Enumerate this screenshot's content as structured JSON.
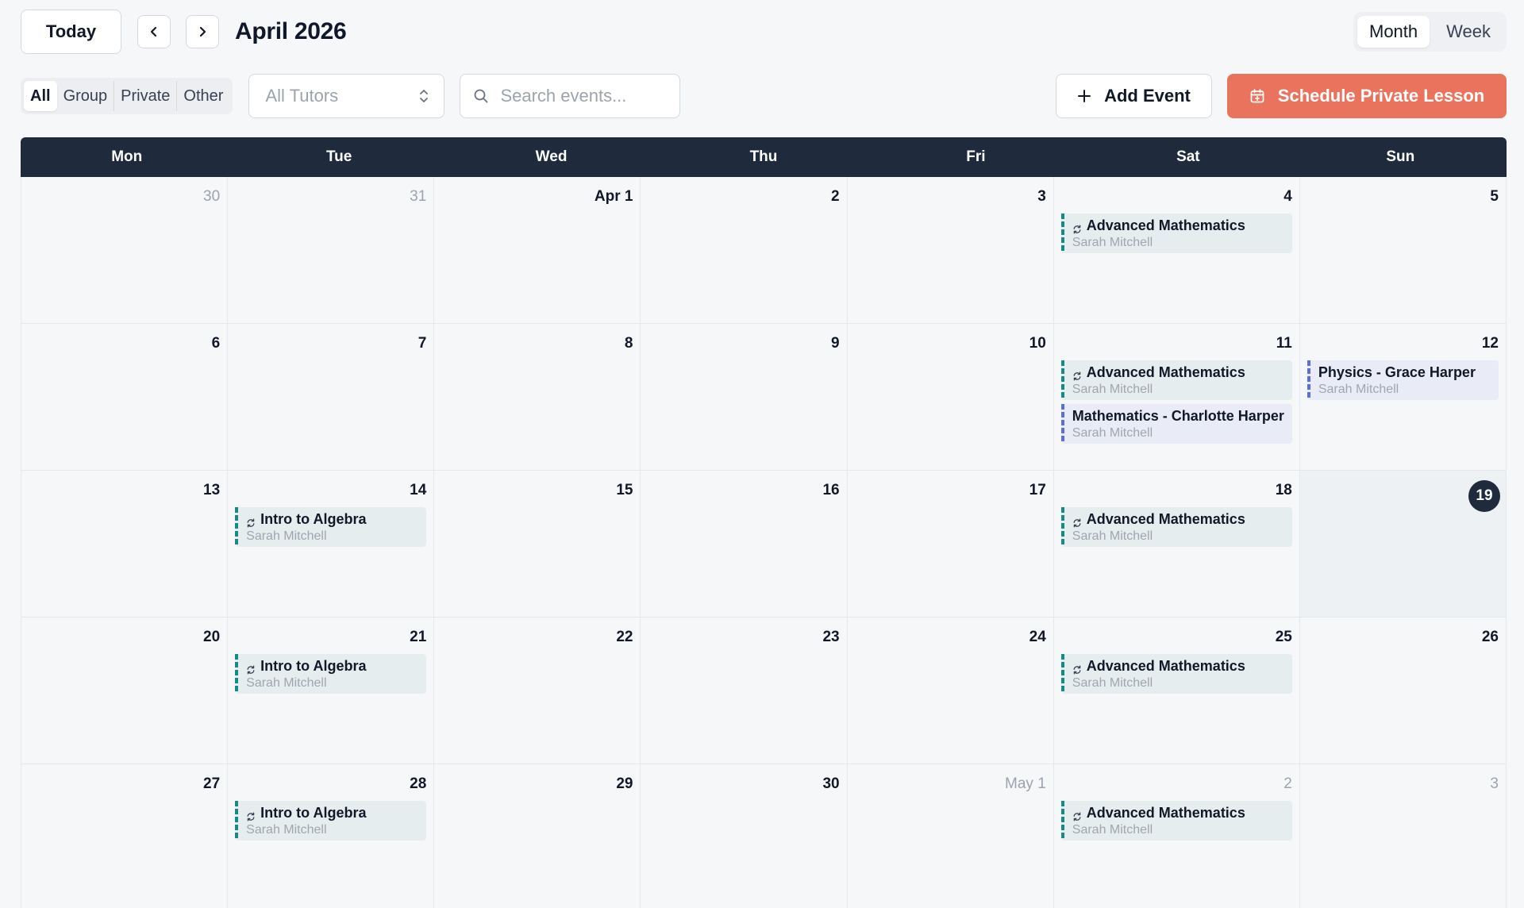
{
  "header": {
    "today_label": "Today",
    "prev_icon": "chevron-left-icon",
    "next_icon": "chevron-right-icon",
    "title": "April 2026",
    "views": [
      {
        "label": "Month",
        "active": true
      },
      {
        "label": "Week",
        "active": false
      }
    ]
  },
  "filters": {
    "types": [
      {
        "label": "All",
        "active": true
      },
      {
        "label": "Group",
        "active": false
      },
      {
        "label": "Private",
        "active": false
      },
      {
        "label": "Other",
        "active": false
      }
    ],
    "tutor_select": {
      "value": "All Tutors",
      "icon": "chevron-up-down-icon"
    },
    "search": {
      "placeholder": "Search events...",
      "value": "",
      "icon": "search-icon"
    },
    "add_event_label": "Add Event",
    "add_event_icon": "plus-icon",
    "schedule_label": "Schedule Private Lesson",
    "schedule_icon": "calendar-plus-icon"
  },
  "colors": {
    "accent": "#e9735c",
    "header_bg": "#1f2a3c",
    "group_event": "#168a86",
    "private_event": "#5b6fdb"
  },
  "calendar": {
    "weekdays": [
      "Mon",
      "Tue",
      "Wed",
      "Thu",
      "Fri",
      "Sat",
      "Sun"
    ],
    "weeks": [
      [
        {
          "label": "30",
          "muted": true,
          "events": []
        },
        {
          "label": "31",
          "muted": true,
          "events": []
        },
        {
          "label": "Apr 1",
          "events": []
        },
        {
          "label": "2",
          "events": []
        },
        {
          "label": "3",
          "events": []
        },
        {
          "label": "4",
          "events": [
            {
              "title": "Advanced Mathematics",
              "tutor": "Sarah Mitchell",
              "type": "group",
              "recurring": true
            }
          ]
        },
        {
          "label": "5",
          "events": []
        }
      ],
      [
        {
          "label": "6",
          "events": []
        },
        {
          "label": "7",
          "events": []
        },
        {
          "label": "8",
          "events": []
        },
        {
          "label": "9",
          "events": []
        },
        {
          "label": "10",
          "events": []
        },
        {
          "label": "11",
          "events": [
            {
              "title": "Advanced Mathematics",
              "tutor": "Sarah Mitchell",
              "type": "group",
              "recurring": true
            },
            {
              "title": "Mathematics - Charlotte Harper",
              "tutor": "Sarah Mitchell",
              "type": "private",
              "recurring": false
            }
          ]
        },
        {
          "label": "12",
          "events": [
            {
              "title": "Physics - Grace Harper",
              "tutor": "Sarah Mitchell",
              "type": "private",
              "recurring": false
            }
          ]
        }
      ],
      [
        {
          "label": "13",
          "events": []
        },
        {
          "label": "14",
          "events": [
            {
              "title": "Intro to Algebra",
              "tutor": "Sarah Mitchell",
              "type": "group",
              "recurring": true
            }
          ]
        },
        {
          "label": "15",
          "events": []
        },
        {
          "label": "16",
          "events": []
        },
        {
          "label": "17",
          "events": []
        },
        {
          "label": "18",
          "events": [
            {
              "title": "Advanced Mathematics",
              "tutor": "Sarah Mitchell",
              "type": "group",
              "recurring": true
            }
          ]
        },
        {
          "label": "19",
          "today": true,
          "events": []
        }
      ],
      [
        {
          "label": "20",
          "events": []
        },
        {
          "label": "21",
          "events": [
            {
              "title": "Intro to Algebra",
              "tutor": "Sarah Mitchell",
              "type": "group",
              "recurring": true
            }
          ]
        },
        {
          "label": "22",
          "events": []
        },
        {
          "label": "23",
          "events": []
        },
        {
          "label": "24",
          "events": []
        },
        {
          "label": "25",
          "events": [
            {
              "title": "Advanced Mathematics",
              "tutor": "Sarah Mitchell",
              "type": "group",
              "recurring": true
            }
          ]
        },
        {
          "label": "26",
          "events": []
        }
      ],
      [
        {
          "label": "27",
          "events": []
        },
        {
          "label": "28",
          "events": [
            {
              "title": "Intro to Algebra",
              "tutor": "Sarah Mitchell",
              "type": "group",
              "recurring": true
            }
          ]
        },
        {
          "label": "29",
          "events": []
        },
        {
          "label": "30",
          "events": []
        },
        {
          "label": "May 1",
          "muted": true,
          "events": []
        },
        {
          "label": "2",
          "muted": true,
          "events": [
            {
              "title": "Advanced Mathematics",
              "tutor": "Sarah Mitchell",
              "type": "group",
              "recurring": true
            }
          ]
        },
        {
          "label": "3",
          "muted": true,
          "events": []
        }
      ]
    ]
  }
}
